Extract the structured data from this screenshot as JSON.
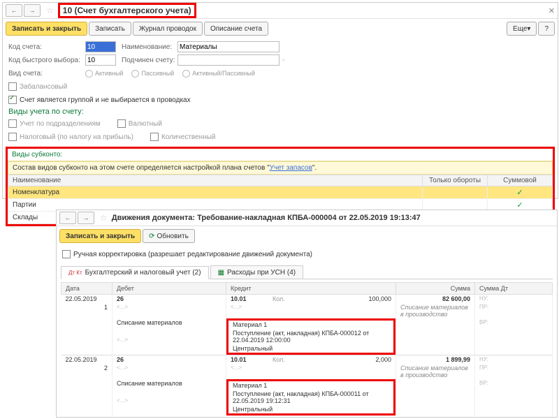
{
  "panel1": {
    "title": "10 (Счет бухгалтерского учета)",
    "save_close": "Записать и закрыть",
    "save": "Записать",
    "journal": "Журнал проводок",
    "desc": "Описание счета",
    "more": "Еще",
    "help": "?",
    "fields": {
      "code_lbl": "Код счета:",
      "code_val": "10",
      "name_lbl": "Наименование:",
      "name_val": "Материалы",
      "quick_lbl": "Код быстрого выбора:",
      "quick_val": "10",
      "parent_lbl": "Подчинен счету:",
      "parent_val": "",
      "kind_lbl": "Вид счета:",
      "kind_a": "Активный",
      "kind_p": "Пассивный",
      "kind_ap": "Активный/Пассивный",
      "offbal": "Забалансовый",
      "group": "Счет является группой и не выбирается в проводках"
    },
    "types_hdr": "Виды учета по счету:",
    "types": {
      "dept": "Учет по подразделениям",
      "curr": "Валютный",
      "tax": "Налоговый (по налогу на прибыль)",
      "qty": "Количественный"
    },
    "subk_hdr": "Виды субконто:",
    "subk_note_pre": "Состав видов субконто на этом счете определяется настройкой плана счетов \"",
    "subk_note_link": "Учет запасов",
    "subk_note_post": "\".",
    "cols": {
      "name": "Наименование",
      "turn": "Только обороты",
      "sum": "Суммовой"
    },
    "rows": [
      {
        "name": "Номенклатура",
        "turn": "",
        "sum": "✓"
      },
      {
        "name": "Партии",
        "turn": "",
        "sum": "✓"
      },
      {
        "name": "Склады",
        "turn": "",
        "sum": "✓"
      }
    ]
  },
  "panel2": {
    "title": "Движения документа: Требование-накладная КПБА-000004 от 22.05.2019 19:13:47",
    "save_close": "Записать и закрыть",
    "refresh": "Обновить",
    "manual": "Ручная корректировка (разрешает редактирование движений документа)",
    "tab1": "Бухгалтерский и налоговый учет (2)",
    "tab2": "Расходы при УСН (4)",
    "cols": {
      "date": "Дата",
      "debit": "Дебет",
      "credit": "Кредит",
      "sum": "Сумма",
      "sumd": "Сумма Дт"
    },
    "rows": [
      {
        "date": "22.05.2019",
        "n": "1",
        "dt": "26",
        "dt_sub": "Списание материалов",
        "ct": "10.01",
        "ct_kol": "Кол.",
        "ct_qty": "100,000",
        "ct_l1": "Материал 1",
        "ct_l2": "Поступление (акт, накладная) КПБА-000012 от 22.04.2019 12:00:00",
        "ct_l3": "Центральный",
        "sum": "82 600,00",
        "desc": "Списание материалов в производство",
        "hy": "НУ:",
        "pr": "ПР:",
        "vr": "ВР:"
      },
      {
        "date": "22.05.2019",
        "n": "2",
        "dt": "26",
        "dt_sub": "Списание материалов",
        "ct": "10.01",
        "ct_kol": "Кол.",
        "ct_qty": "2,000",
        "ct_l1": "Материал 1",
        "ct_l2": "Поступление (акт, накладная) КПБА-000011 от 22.05.2019 19:12:31",
        "ct_l3": "Центральный",
        "sum": "1 899,99",
        "desc": "Списание материалов в производство",
        "hy": "НУ:",
        "pr": "ПР:",
        "vr": "ВР:"
      }
    ]
  }
}
